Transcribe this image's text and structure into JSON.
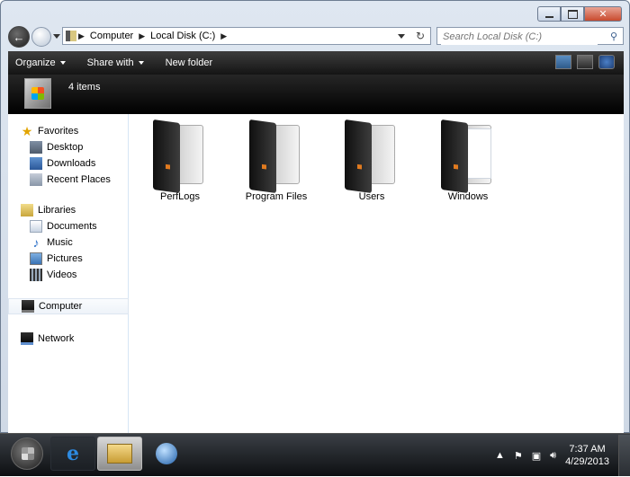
{
  "address": {
    "crumbs": [
      "Computer",
      "Local Disk (C:)"
    ]
  },
  "search": {
    "placeholder": "Search Local Disk (C:)"
  },
  "toolbar": {
    "organize": "Organize",
    "share_with": "Share with",
    "new_folder": "New folder"
  },
  "header": {
    "item_count": "4 items"
  },
  "nav": {
    "favorites": {
      "label": "Favorites",
      "items": [
        "Desktop",
        "Downloads",
        "Recent Places"
      ]
    },
    "libraries": {
      "label": "Libraries",
      "items": [
        "Documents",
        "Music",
        "Pictures",
        "Videos"
      ]
    },
    "computer": "Computer",
    "network": "Network"
  },
  "folders": [
    "PerfLogs",
    "Program Files",
    "Users",
    "Windows"
  ],
  "taskbar": {
    "time": "7:37 AM",
    "date": "4/29/2013"
  },
  "icons": [
    "back-icon",
    "forward-icon",
    "refresh-icon",
    "search-icon",
    "view-icon",
    "preview-pane-icon",
    "help-icon",
    "drive-icon",
    "start-icon",
    "ie-icon",
    "explorer-icon",
    "media-player-icon",
    "flag-icon",
    "network-tray-icon",
    "volume-icon"
  ]
}
